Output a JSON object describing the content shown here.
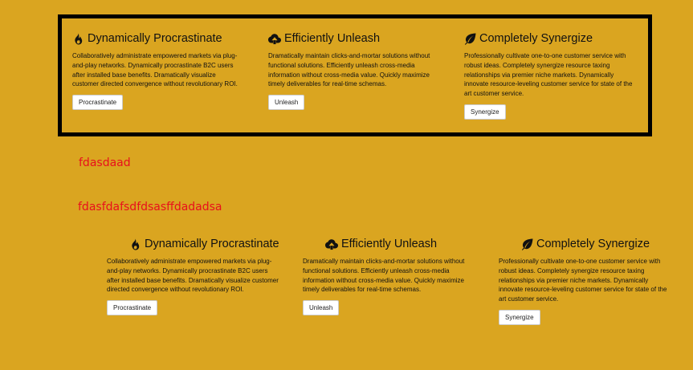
{
  "top_section": {
    "columns": [
      {
        "icon": "fire-icon",
        "title": "Dynamically Procrastinate",
        "text": "Collaboratively administrate empowered markets via plug-and-play networks. Dynamically procrastinate B2C users after installed base benefits. Dramatically visualize customer directed convergence without revolutionary ROI.",
        "button": "Procrastinate"
      },
      {
        "icon": "cloud-upload-icon",
        "title": "Efficiently Unleash",
        "text": "Dramatically maintain clicks-and-mortar solutions without functional solutions. Efficiently unleash cross-media information without cross-media value. Quickly maximize timely deliverables for real-time schemas.",
        "button": "Unleash"
      },
      {
        "icon": "leaf-icon",
        "title": "Completely Synergize",
        "text": "Professionally cultivate one-to-one customer service with robust ideas. Completely synergize resource taxing relationships via premier niche markets. Dynamically innovate resource-leveling customer service for state of the art customer service.",
        "button": "Synergize"
      }
    ]
  },
  "red_text": {
    "line1": "fdasdaad",
    "line2": "fdasfdafsdfdsasffdadadsa"
  },
  "bottom_section": {
    "columns": [
      {
        "icon": "fire-icon",
        "title": "Dynamically Procrastinate",
        "text": "Collaboratively administrate empowered markets via plug-and-play networks. Dynamically procrastinate B2C users after installed base benefits. Dramatically visualize customer directed convergence without revolutionary ROI.",
        "button": "Procrastinate"
      },
      {
        "icon": "cloud-upload-icon",
        "title": "Efficiently Unleash",
        "text": "Dramatically maintain clicks-and-mortar solutions without functional solutions. Efficiently unleash cross-media information without cross-media value. Quickly maximize timely deliverables for real-time schemas.",
        "button": "Unleash"
      },
      {
        "icon": "leaf-icon",
        "title": "Completely Synergize",
        "text": "Professionally cultivate one-to-one customer service with robust ideas. Completely synergize resource taxing relationships via premier niche markets. Dynamically innovate resource-leveling customer service for state of the art customer service.",
        "button": "Synergize"
      }
    ]
  },
  "colors": {
    "background": "#DAA520",
    "border": "#000000",
    "red_text": "#E8101C"
  }
}
